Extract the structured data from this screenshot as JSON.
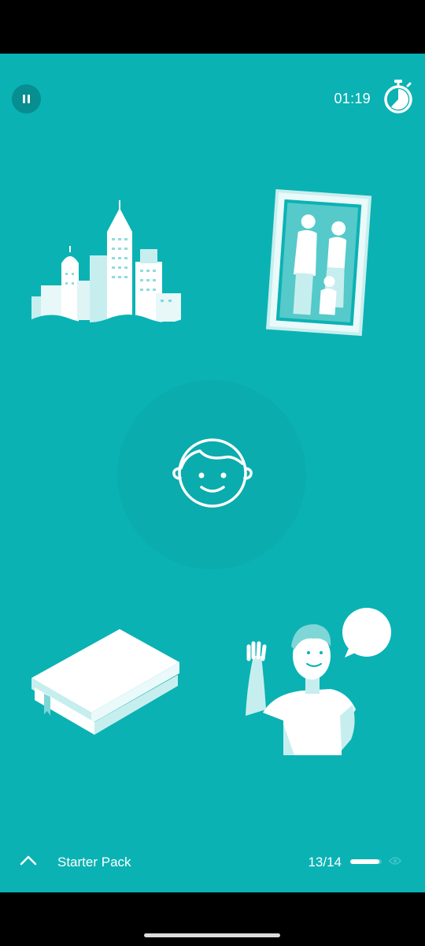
{
  "timer": {
    "text": "01:19",
    "icon": "stopwatch-icon"
  },
  "controls": {
    "pause_icon": "pause-icon"
  },
  "illustrations": [
    "city-skyline",
    "family-photo-frame",
    "face-icon",
    "book",
    "waving-man-speech-bubble"
  ],
  "footer": {
    "pack_title": "Starter Pack",
    "progress_text": "13/14",
    "progress_fraction": 0.93,
    "expand_icon": "chevron-up-icon",
    "eye_icon": "eye-icon"
  },
  "colors": {
    "background": "#0ab2b4",
    "accent_dark": "#078e90",
    "foreground": "#ffffff"
  }
}
